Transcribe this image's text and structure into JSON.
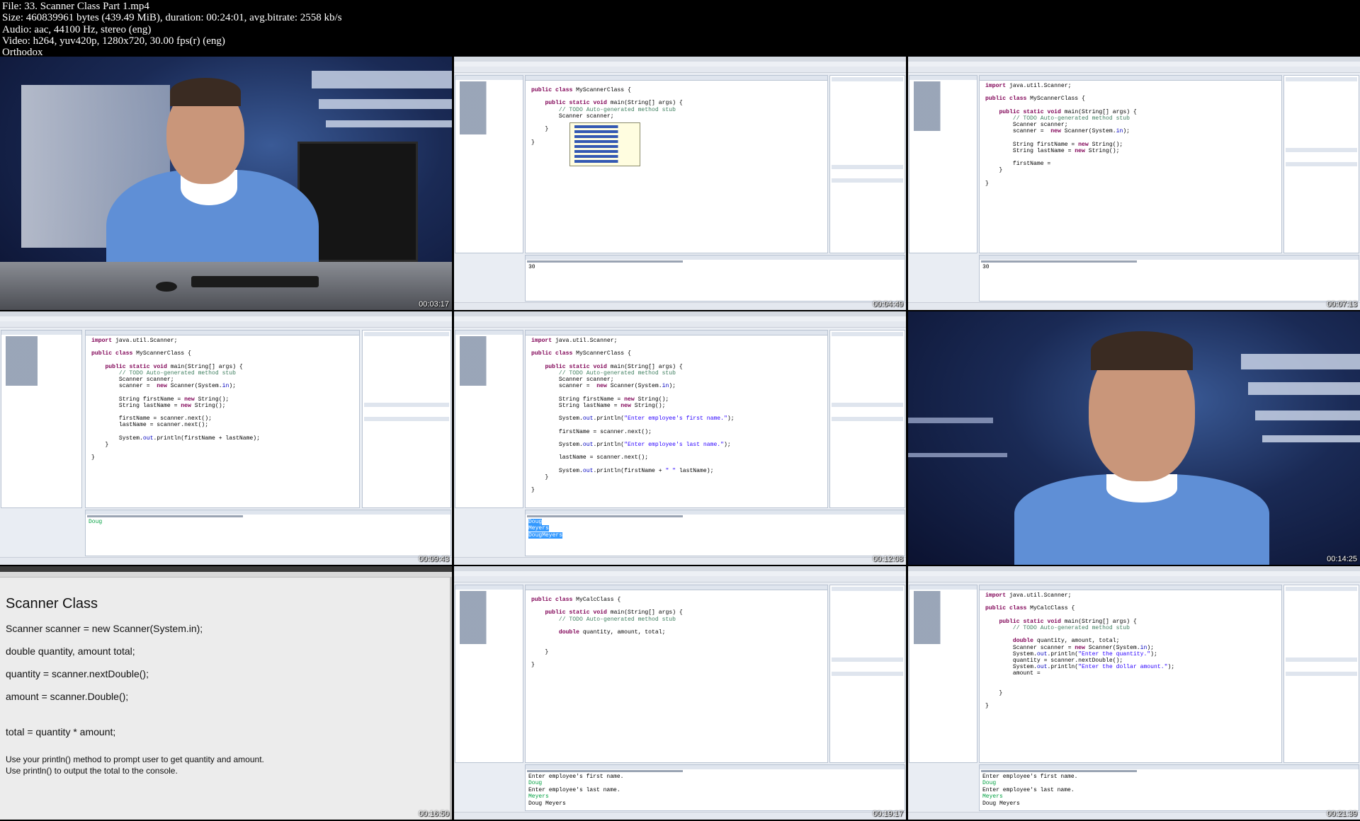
{
  "header": {
    "file": "File: 33. Scanner Class Part 1.mp4",
    "size": "Size: 460839961 bytes (439.49 MiB), duration: 00:24:01, avg.bitrate: 2558 kb/s",
    "audio": "Audio: aac, 44100 Hz, stereo (eng)",
    "video": "Video: h264, yuv420p, 1280x720, 30.00 fps(r) (eng)",
    "label": "Orthodox"
  },
  "tiles": [
    {
      "timestamp": "00:03:17",
      "type": "studio"
    },
    {
      "timestamp": "00:04:49",
      "type": "ide"
    },
    {
      "timestamp": "00:07:13",
      "type": "ide"
    },
    {
      "timestamp": "00:09:43",
      "type": "ide"
    },
    {
      "timestamp": "00:12:08",
      "type": "ide"
    },
    {
      "timestamp": "00:14:25",
      "type": "studio"
    },
    {
      "timestamp": "00:16:50",
      "type": "slide"
    },
    {
      "timestamp": "00:19:17",
      "type": "ide"
    },
    {
      "timestamp": "00:21:39",
      "type": "ide"
    }
  ],
  "code": {
    "t2": [
      "public class MyScannerClass {",
      "",
      "    public static void main(String[] args) {",
      "        // TODO Auto-generated method stub",
      "        Scanner scanner;",
      "",
      "    }",
      "",
      "}"
    ],
    "t2_console": [
      "30"
    ],
    "t3": [
      "import java.util.Scanner;",
      "",
      "public class MyScannerClass {",
      "",
      "    public static void main(String[] args) {",
      "        // TODO Auto-generated method stub",
      "        Scanner scanner;",
      "        scanner =  new Scanner(System.in);",
      "",
      "        String firstName = new String();",
      "        String lastName = new String();",
      "",
      "        firstName =",
      "    }",
      "",
      "}"
    ],
    "t3_console": [
      "30"
    ],
    "t4": [
      "import java.util.Scanner;",
      "",
      "public class MyScannerClass {",
      "",
      "    public static void main(String[] args) {",
      "        // TODO Auto-generated method stub",
      "        Scanner scanner;",
      "        scanner =  new Scanner(System.in);",
      "",
      "        String firstName = new String();",
      "        String lastName = new String();",
      "",
      "        firstName = scanner.next();",
      "        lastName = scanner.next();",
      "",
      "        System.out.println(firstName + lastName);",
      "    }",
      "",
      "}"
    ],
    "t4_console": [
      "Doug"
    ],
    "t5": [
      "import java.util.Scanner;",
      "",
      "public class MyScannerClass {",
      "",
      "    public static void main(String[] args) {",
      "        // TODO Auto-generated method stub",
      "        Scanner scanner;",
      "        scanner =  new Scanner(System.in);",
      "",
      "        String firstName = new String();",
      "        String lastName = new String();",
      "",
      "        System.out.println(\"Enter employee's first name.\");",
      "",
      "        firstName = scanner.next();",
      "",
      "        System.out.println(\"Enter employee's last name.\");",
      "",
      "        lastName = scanner.next();",
      "",
      "        System.out.println(firstName + \" \" lastName);",
      "    }",
      "",
      "}"
    ],
    "t5_console": [
      "Doug",
      "Meyers",
      "DougMeyers"
    ],
    "t8": [
      "public class MyCalcClass {",
      "",
      "    public static void main(String[] args) {",
      "        // TODO Auto-generated method stub",
      "",
      "        double quantity, amount, total;",
      "",
      "",
      "    }",
      "",
      "}"
    ],
    "t8_console": [
      "Enter employee's first name.",
      "Doug",
      "Enter employee's last name.",
      "Meyers",
      "Doug Meyers"
    ],
    "t9": [
      "import java.util.Scanner;",
      "",
      "public class MyCalcClass {",
      "",
      "    public static void main(String[] args) {",
      "        // TODO Auto-generated method stub",
      "",
      "        double quantity, amount, total;",
      "        Scanner scanner = new Scanner(System.in);",
      "        System.out.println(\"Enter the quantity.\");",
      "        quantity = scanner.nextDouble();",
      "        System.out.println(\"Enter the dollar amount.\");",
      "        amount =",
      "",
      "",
      "    }",
      "",
      "}"
    ],
    "t9_console": [
      "Enter employee's first name.",
      "Doug",
      "Enter employee's last name.",
      "Meyers",
      "Doug Meyers"
    ]
  },
  "slide": {
    "title": "Scanner Class",
    "lines": [
      "Scanner scanner = new Scanner(System.in);",
      "double quantity, amount total;",
      "quantity = scanner.nextDouble();",
      "amount = scanner.Double();",
      "total = quantity * amount;"
    ],
    "note1": "Use your println() method to prompt user to get quantity and amount.",
    "note2": "Use println() to output the total to the console."
  }
}
